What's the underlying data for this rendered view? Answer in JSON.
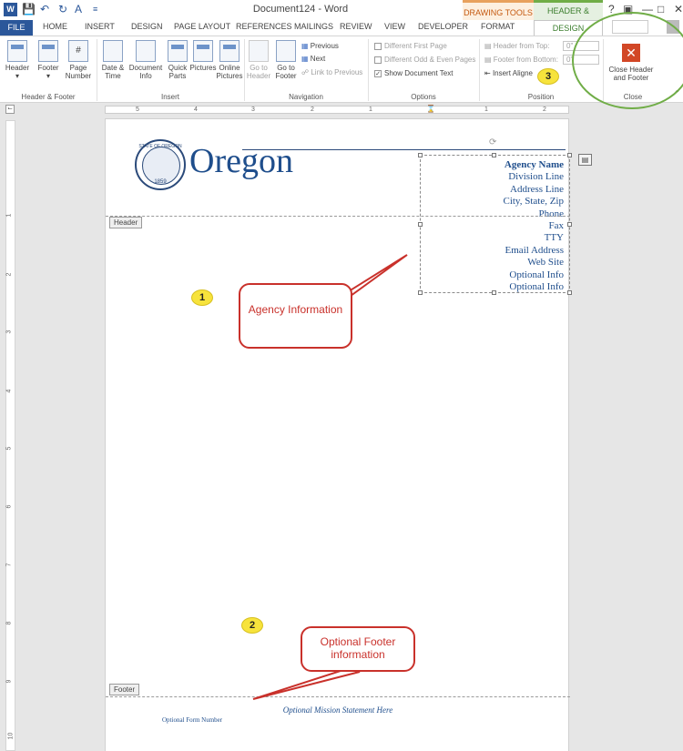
{
  "titlebar": {
    "doc_title": "Document124 - Word",
    "context_drawing": "DRAWING TOOLS",
    "context_header": "HEADER & FOOTER...",
    "help": "?"
  },
  "tabs": [
    "FILE",
    "HOME",
    "INSERT",
    "DESIGN",
    "PAGE LAYOUT",
    "REFERENCES",
    "MAILINGS",
    "REVIEW",
    "VIEW",
    "DEVELOPER",
    "FORMAT",
    "DESIGN"
  ],
  "ribbon": {
    "header_footer": {
      "header": "Header",
      "footer": "Footer",
      "page_number": "Page Number",
      "label": "Header & Footer"
    },
    "insert": {
      "date_time": "Date & Time",
      "document_info": "Document Info",
      "quick_parts": "Quick Parts",
      "pictures": "Pictures",
      "online_pictures": "Online Pictures",
      "label": "Insert"
    },
    "navigation": {
      "go_to_header": "Go to Header",
      "go_to_footer": "Go to Footer",
      "previous": "Previous",
      "next": "Next",
      "link_to_previous": "Link to Previous",
      "label": "Navigation"
    },
    "options": {
      "different_first_page": "Different First Page",
      "different_odd_even": "Different Odd & Even Pages",
      "show_document_text": "Show Document Text",
      "label": "Options"
    },
    "position": {
      "header_from_top": "Header from Top:",
      "header_from_top_value": "0\"",
      "footer_from_bottom": "Footer from Bottom:",
      "footer_from_bottom_value": "0\"",
      "insert_alignment": "Insert Aligne",
      "label": "Position"
    },
    "close": {
      "button": "Close Header and Footer",
      "label": "Close"
    }
  },
  "ruler": {
    "h": [
      "5",
      "4",
      "3",
      "2",
      "1",
      "1",
      "2"
    ],
    "v": [
      "1",
      "2",
      "3",
      "4",
      "5",
      "6",
      "7",
      "8",
      "9",
      "10"
    ]
  },
  "document": {
    "header_tag": "Header",
    "footer_tag": "Footer",
    "seal_top": "STATE OF OREGON",
    "seal_year": "1859",
    "oregon": "Oregon",
    "agency_lines": [
      "Agency Name",
      "Division Line",
      "Address Line",
      "City, State, Zip",
      "Phone",
      "Fax",
      "TTY",
      "Email Address",
      "Web Site",
      "Optional Info",
      "Optional Info"
    ],
    "footer_mission": "Optional Mission Statement Here",
    "footer_form": "Optional Form Number"
  },
  "annotations": {
    "badge1": "1",
    "badge2": "2",
    "badge3": "3",
    "callout_agency": "Agency Information",
    "callout_footer": "Optional Footer information"
  }
}
